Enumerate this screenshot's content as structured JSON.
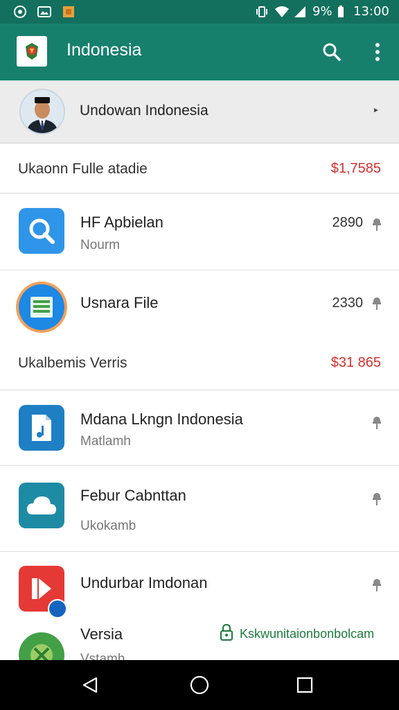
{
  "status_bar": {
    "battery": "9%",
    "time": "13:00",
    "icons": [
      "shield-icon",
      "image-icon",
      "file-icon",
      "vibrate-icon",
      "wifi-icon",
      "signal-icon",
      "battery-icon"
    ]
  },
  "app_bar": {
    "title": "Indonesia",
    "logo_icon": "coat-of-arms-icon",
    "actions": [
      "search-icon",
      "more-vert-icon"
    ]
  },
  "profile": {
    "name": "Undowan Indonesia",
    "avatar_icon": "avatar"
  },
  "sections": [
    {
      "label": "Ukaonn Fulle atadie",
      "amount": "$1,7585"
    },
    {
      "label": "Ukalbemis Verris",
      "amount": "$31 865"
    }
  ],
  "items": [
    {
      "title": "HF Apbielan",
      "subtitle": "Nourm",
      "count": "2890",
      "icon": "search-app-icon",
      "color": "#2f95e8"
    },
    {
      "title": "Usnara File",
      "subtitle": "",
      "count": "2330",
      "icon": "document-app-icon",
      "color": "#1e88e5"
    },
    {
      "title": "Mdana Lkngn Indonesia",
      "subtitle": "Matlamh",
      "count": "",
      "icon": "file-music-icon",
      "color": "#1e7fc4"
    },
    {
      "title": "Febur Cabnttan",
      "subtitle": "Ukokamb",
      "count": "",
      "icon": "cloud-icon",
      "color": "#1e8ba5"
    },
    {
      "title": "Undurbar Imdonan",
      "subtitle": "",
      "count": "",
      "icon": "play-icon",
      "color": "#e53935"
    },
    {
      "title": "Versia",
      "subtitle": "Vstamh",
      "count": "",
      "icon": "compass-icon",
      "color": "#43a047"
    }
  ],
  "link": {
    "text": "Kskwunitaionbonbolcam",
    "icon": "lock-icon",
    "color": "#1b7a3e"
  },
  "nav_bar": [
    "back-icon",
    "home-icon",
    "recents-icon"
  ]
}
